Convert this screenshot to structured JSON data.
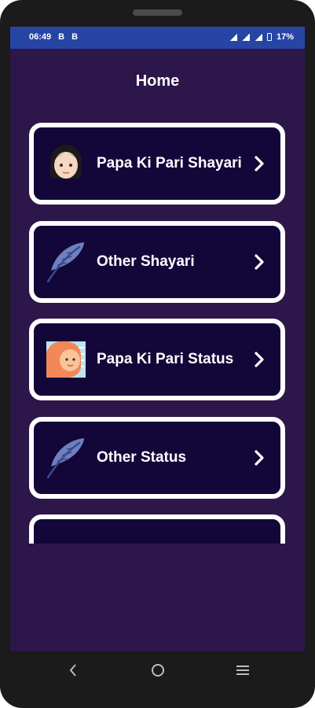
{
  "status_bar": {
    "time": "06:49",
    "notif_1": "B",
    "notif_2": "B",
    "battery": "17%"
  },
  "header": {
    "title": "Home"
  },
  "menu": [
    {
      "label": "Papa Ki Pari Shayari",
      "icon": "girl-face-icon"
    },
    {
      "label": "Other Shayari",
      "icon": "feather-icon"
    },
    {
      "label": "Papa Ki Pari Status",
      "icon": "girl-avatar-icon"
    },
    {
      "label": "Other Status",
      "icon": "feather-icon"
    },
    {
      "label": "",
      "icon": "emoji-icon"
    }
  ],
  "colors": {
    "background": "#2d1649",
    "card": "#13073a",
    "card_border": "#ffffff",
    "status_bar": "#2745a5"
  }
}
